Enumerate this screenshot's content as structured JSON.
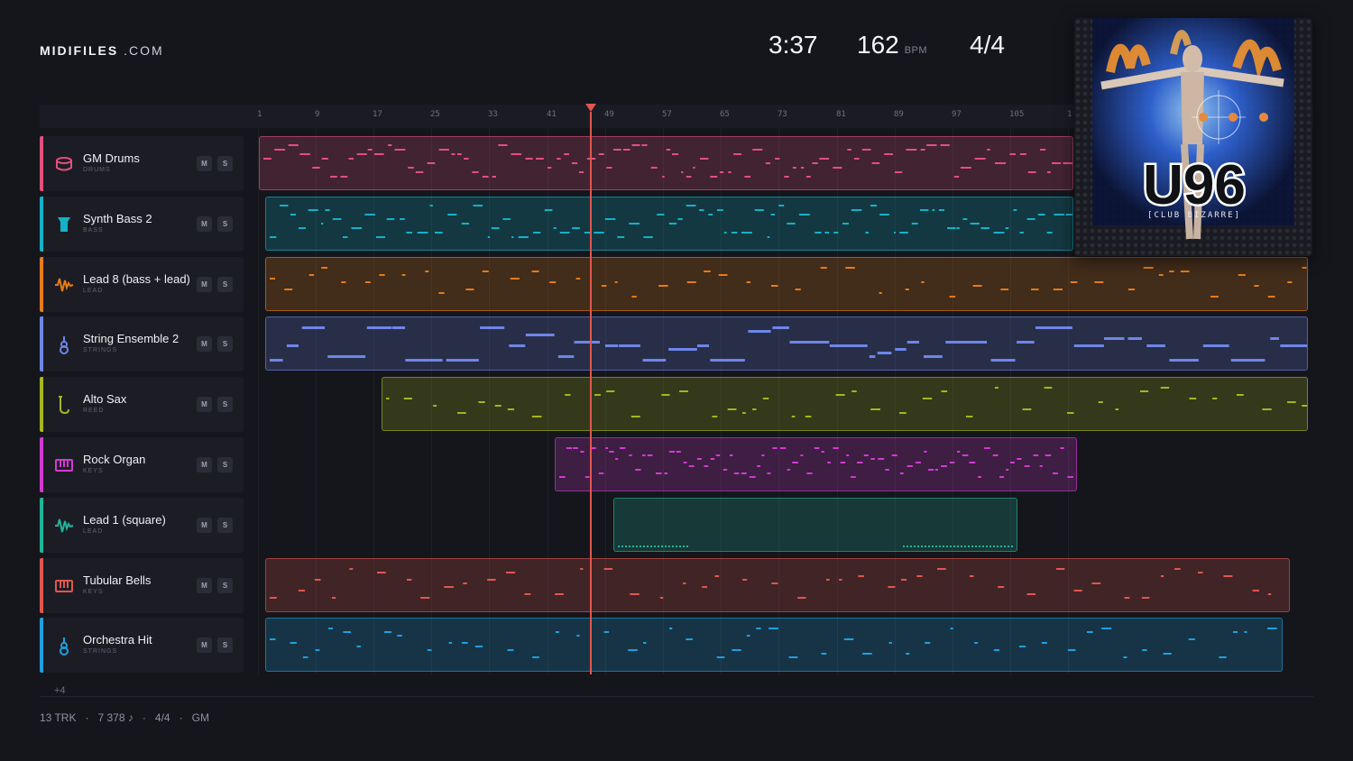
{
  "brand": {
    "name_bold": "MIDIFILES",
    "name_suffix": ".COM"
  },
  "transport": {
    "time": "3:37",
    "tempo": "162",
    "tempo_unit": "BPM",
    "time_signature": "4/4"
  },
  "ruler": {
    "bars": [
      "1",
      "9",
      "17",
      "25",
      "33",
      "41",
      "49",
      "57",
      "65",
      "73",
      "81",
      "89",
      "97",
      "105",
      "1"
    ]
  },
  "tracks": [
    {
      "name": "GM Drums",
      "category": "DRUMS",
      "color": "#e2507f",
      "icon": "drum-icon",
      "mute": "M",
      "solo": "S"
    },
    {
      "name": "Synth Bass 2",
      "category": "BASS",
      "color": "#13b2c9",
      "icon": "bass-icon",
      "mute": "M",
      "solo": "S"
    },
    {
      "name": "Lead 8 (bass + lead)",
      "category": "LEAD",
      "color": "#e57c19",
      "icon": "waveform-icon",
      "mute": "M",
      "solo": "S"
    },
    {
      "name": "String Ensemble 2",
      "category": "STRINGS",
      "color": "#6d86e8",
      "icon": "violin-icon",
      "mute": "M",
      "solo": "S"
    },
    {
      "name": "Alto Sax",
      "category": "REED",
      "color": "#a4b61e",
      "icon": "saxophone-icon",
      "mute": "M",
      "solo": "S"
    },
    {
      "name": "Rock Organ",
      "category": "KEYS",
      "color": "#d23ad2",
      "icon": "keyboard-icon",
      "mute": "M",
      "solo": "S"
    },
    {
      "name": "Lead 1 (square)",
      "category": "LEAD",
      "color": "#1fb59c",
      "icon": "waveform-icon",
      "mute": "M",
      "solo": "S"
    },
    {
      "name": "Tubular Bells",
      "category": "KEYS",
      "color": "#e0574f",
      "icon": "keyboard-icon",
      "mute": "M",
      "solo": "S"
    },
    {
      "name": "Orchestra Hit",
      "category": "STRINGS",
      "color": "#1f9fe0",
      "icon": "violin-icon",
      "mute": "M",
      "solo": "S"
    }
  ],
  "footer": {
    "more_tracks": "+4",
    "track_count": "13 TRK",
    "note_count": "7 378 ♪",
    "time_signature": "4/4",
    "standard": "GM",
    "separator": "·"
  },
  "cover": {
    "title": "U96",
    "subtitle": "[CLUB BIZARRE]"
  },
  "colors": {
    "background": "#15161c",
    "playhead": "#e0574f"
  }
}
